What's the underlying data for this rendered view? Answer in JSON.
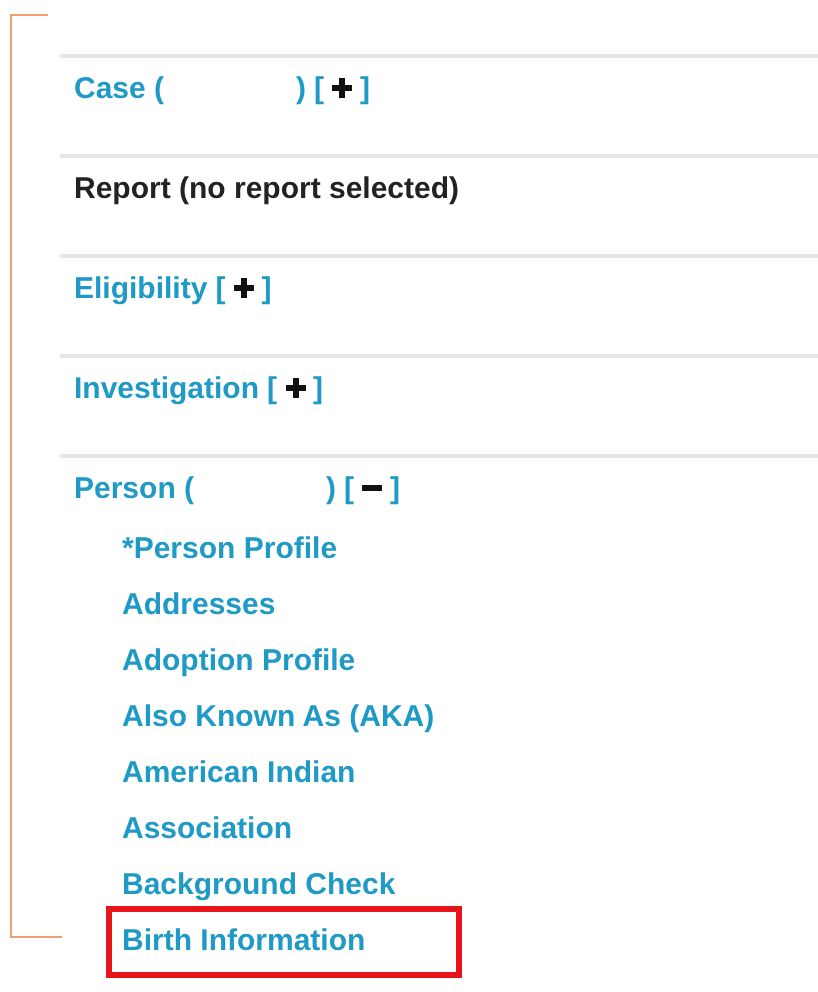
{
  "sections": [
    {
      "kind": "link",
      "title": "Case (",
      "title_end": ")",
      "bracket_open": "[",
      "bracket_close": "]",
      "expanded": false
    },
    {
      "kind": "plain",
      "title": "Report (no report selected)"
    },
    {
      "kind": "link",
      "title": "Eligibility",
      "bracket_open": "[",
      "bracket_close": "]",
      "expanded": false
    },
    {
      "kind": "link",
      "title": "Investigation",
      "bracket_open": "[",
      "bracket_close": "]",
      "expanded": false
    },
    {
      "kind": "link",
      "title": "Person (",
      "title_end": ")",
      "bracket_open": "[",
      "bracket_close": "]",
      "expanded": true,
      "children": [
        {
          "label": "*Person Profile",
          "selected": false
        },
        {
          "label": "Addresses",
          "selected": false
        },
        {
          "label": "Adoption Profile",
          "selected": false
        },
        {
          "label": "Also Known As (AKA)",
          "selected": false
        },
        {
          "label": "American Indian",
          "selected": false
        },
        {
          "label": "Association",
          "selected": false
        },
        {
          "label": "Background Check",
          "selected": false
        },
        {
          "label": "Birth Information",
          "selected": true
        }
      ]
    }
  ]
}
